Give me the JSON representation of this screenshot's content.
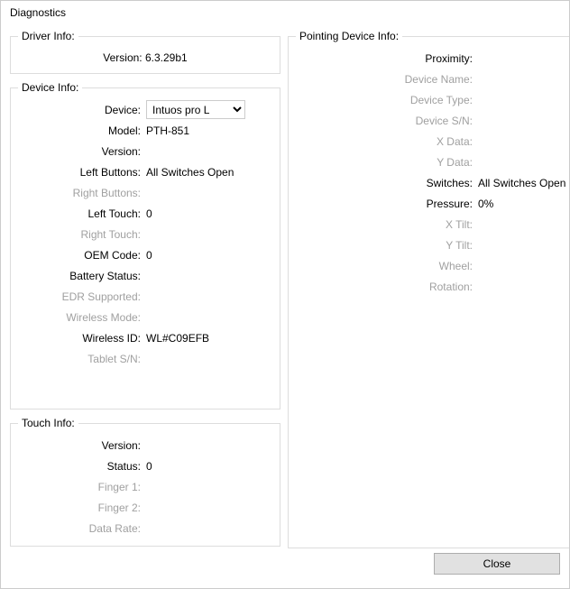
{
  "window": {
    "title": "Diagnostics"
  },
  "driver": {
    "legend": "Driver Info:",
    "version_label": "Version:",
    "version_value": "6.3.29b1"
  },
  "device": {
    "legend": "Device Info:",
    "device_label": "Device:",
    "device_selected": "Intuos pro L",
    "model_label": "Model:",
    "model_value": "PTH-851",
    "version_label": "Version:",
    "version_value": "",
    "left_buttons_label": "Left Buttons:",
    "left_buttons_value": "All Switches Open",
    "right_buttons_label": "Right Buttons:",
    "right_buttons_value": "",
    "left_touch_label": "Left Touch:",
    "left_touch_value": "0",
    "right_touch_label": "Right Touch:",
    "right_touch_value": "",
    "oem_code_label": "OEM Code:",
    "oem_code_value": "0",
    "battery_status_label": "Battery Status:",
    "battery_status_value": "",
    "edr_supported_label": "EDR Supported:",
    "edr_supported_value": "",
    "wireless_mode_label": "Wireless Mode:",
    "wireless_mode_value": "",
    "wireless_id_label": "Wireless ID:",
    "wireless_id_value": "WL#C09EFB",
    "tablet_sn_label": "Tablet S/N:",
    "tablet_sn_value": ""
  },
  "touch": {
    "legend": "Touch Info:",
    "version_label": "Version:",
    "version_value": "",
    "status_label": "Status:",
    "status_value": "0",
    "finger1_label": "Finger 1:",
    "finger1_value": "",
    "finger2_label": "Finger 2:",
    "finger2_value": "",
    "data_rate_label": "Data Rate:",
    "data_rate_value": ""
  },
  "pointing": {
    "legend": "Pointing Device Info:",
    "proximity_label": "Proximity:",
    "proximity_value": "",
    "device_name_label": "Device Name:",
    "device_name_value": "",
    "device_type_label": "Device Type:",
    "device_type_value": "",
    "device_sn_label": "Device S/N:",
    "device_sn_value": "",
    "x_data_label": "X Data:",
    "x_data_value": "",
    "y_data_label": "Y Data:",
    "y_data_value": "",
    "switches_label": "Switches:",
    "switches_value": "All Switches Open",
    "pressure_label": "Pressure:",
    "pressure_value": "0%",
    "x_tilt_label": "X Tilt:",
    "x_tilt_value": "",
    "y_tilt_label": "Y Tilt:",
    "y_tilt_value": "",
    "wheel_label": "Wheel:",
    "wheel_value": "",
    "rotation_label": "Rotation:",
    "rotation_value": ""
  },
  "buttons": {
    "close": "Close"
  }
}
